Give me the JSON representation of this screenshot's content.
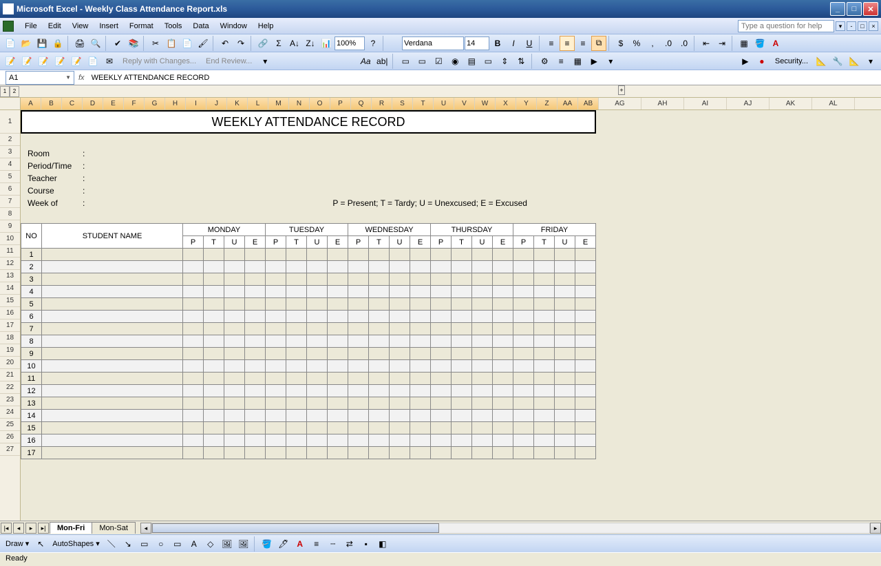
{
  "app_title": "Microsoft Excel - Weekly Class Attendance Report.xls",
  "menus": [
    "File",
    "Edit",
    "View",
    "Insert",
    "Format",
    "Tools",
    "Data",
    "Window",
    "Help"
  ],
  "help_placeholder": "Type a question for help",
  "font_name": "Verdana",
  "font_size": "14",
  "zoom": "100%",
  "reply_label": "Reply with Changes...",
  "end_review_label": "End Review...",
  "security_label": "Security...",
  "name_box": "A1",
  "formula_value": "WEEKLY ATTENDANCE RECORD",
  "outline_levels": [
    "1",
    "2"
  ],
  "col_letters_narrow": [
    "A",
    "B",
    "C",
    "D",
    "E",
    "F",
    "G",
    "H",
    "I",
    "J",
    "K",
    "L",
    "M",
    "N",
    "O",
    "P",
    "Q",
    "R",
    "S",
    "T",
    "U",
    "V",
    "W",
    "X",
    "Y",
    "Z",
    "AA",
    "AB"
  ],
  "col_letters_wide": [
    "AG",
    "AH",
    "AI",
    "AJ",
    "AK",
    "AL"
  ],
  "row_numbers": [
    "1",
    "2",
    "3",
    "4",
    "5",
    "6",
    "7",
    "8",
    "9",
    "10",
    "11",
    "12",
    "13",
    "14",
    "15",
    "16",
    "17",
    "18",
    "19",
    "20",
    "21",
    "22",
    "23",
    "24",
    "25",
    "26",
    "27"
  ],
  "doc": {
    "title": "WEEKLY ATTENDANCE RECORD",
    "info_labels": [
      "Room",
      "Period/Time",
      "Teacher",
      "Course",
      "Week of"
    ],
    "legend": "P = Present; T = Tardy; U = Unexcused; E = Excused",
    "table": {
      "no_header": "NO",
      "name_header": "STUDENT NAME",
      "days": [
        "MONDAY",
        "TUESDAY",
        "WEDNESDAY",
        "THURSDAY",
        "FRIDAY"
      ],
      "codes": [
        "P",
        "T",
        "U",
        "E"
      ],
      "rows": [
        "1",
        "2",
        "3",
        "4",
        "5",
        "6",
        "7",
        "8",
        "9",
        "10",
        "11",
        "12",
        "13",
        "14",
        "15",
        "16",
        "17"
      ]
    }
  },
  "sheet_tabs": [
    "Mon-Fri",
    "Mon-Sat"
  ],
  "draw_label": "Draw",
  "autoshapes_label": "AutoShapes",
  "status": "Ready"
}
